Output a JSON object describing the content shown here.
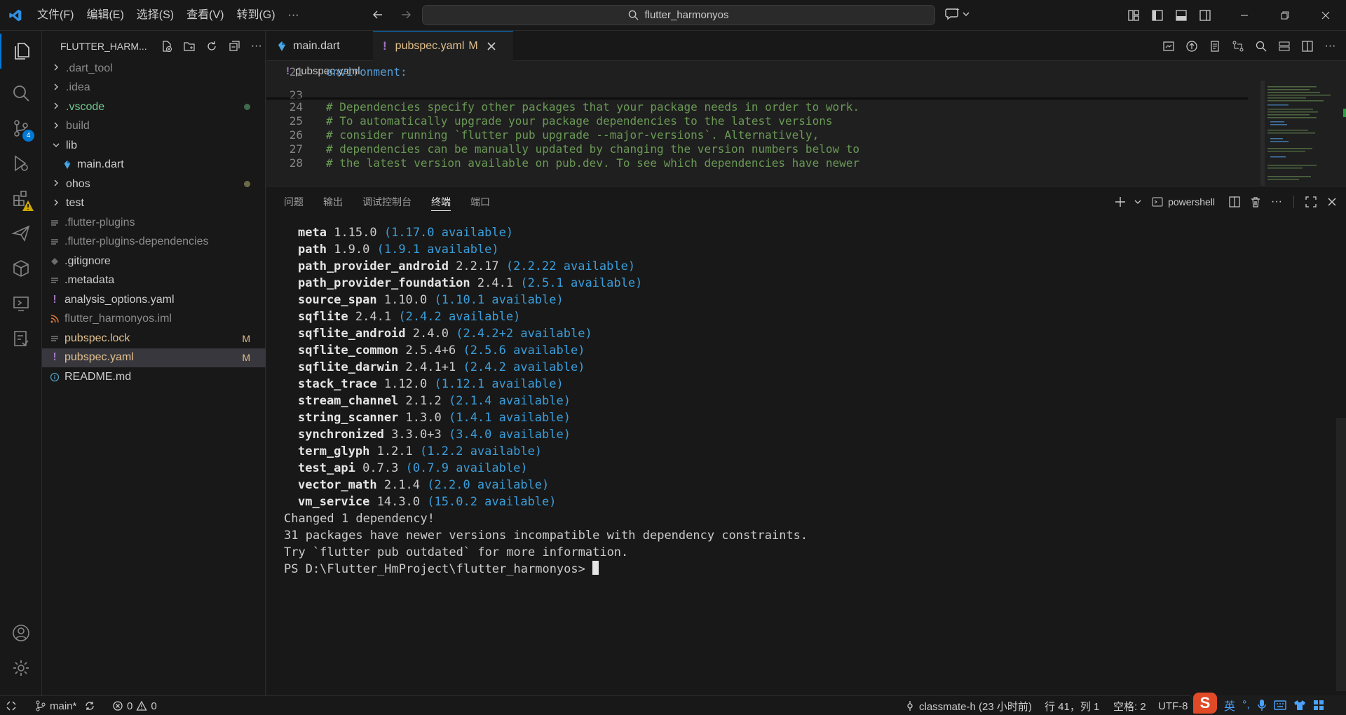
{
  "titlebar": {
    "menus": [
      "文件(F)",
      "编辑(E)",
      "选择(S)",
      "查看(V)",
      "转到(G)",
      "···"
    ],
    "search": "flutter_harmonyos"
  },
  "activity": {
    "source_control_badge": "4"
  },
  "explorer": {
    "title": "FLUTTER_HARM...",
    "items": [
      {
        "label": ".dart_tool",
        "type": "folder",
        "color": "#8b8b8b",
        "deco": ""
      },
      {
        "label": ".idea",
        "type": "folder",
        "color": "#8b8b8b",
        "deco": ""
      },
      {
        "label": ".vscode",
        "type": "folder",
        "color": "#73c991",
        "deco": "dot-green"
      },
      {
        "label": "build",
        "type": "folder",
        "color": "#8b8b8b",
        "deco": ""
      },
      {
        "label": "lib",
        "type": "folder-open",
        "color": "#cccccc",
        "deco": ""
      },
      {
        "label": "main.dart",
        "type": "dart",
        "color": "#cccccc",
        "deco": ""
      },
      {
        "label": "ohos",
        "type": "folder",
        "color": "#cccccc",
        "deco": "dot"
      },
      {
        "label": "test",
        "type": "folder",
        "color": "#cccccc",
        "deco": ""
      },
      {
        "label": ".flutter-plugins",
        "type": "lines",
        "color": "#8b8b8b",
        "deco": ""
      },
      {
        "label": ".flutter-plugins-dependencies",
        "type": "lines",
        "color": "#8b8b8b",
        "deco": ""
      },
      {
        "label": ".gitignore",
        "type": "git",
        "color": "#cccccc",
        "deco": ""
      },
      {
        "label": ".metadata",
        "type": "lines",
        "color": "#cccccc",
        "deco": ""
      },
      {
        "label": "analysis_options.yaml",
        "type": "yaml",
        "color": "#cccccc",
        "deco": ""
      },
      {
        "label": "flutter_harmonyos.iml",
        "type": "rss",
        "color": "#8b8b8b",
        "deco": ""
      },
      {
        "label": "pubspec.lock",
        "type": "lines",
        "color": "#e2c08d",
        "deco": "M"
      },
      {
        "label": "pubspec.yaml",
        "type": "yaml",
        "color": "#e2c08d",
        "deco": "M",
        "selected": true
      },
      {
        "label": "README.md",
        "type": "info",
        "color": "#cccccc",
        "deco": ""
      }
    ]
  },
  "tabs": [
    {
      "label": "main.dart",
      "active": false
    },
    {
      "label": "pubspec.yaml",
      "modified": "M",
      "active": true
    }
  ],
  "editor": {
    "breadcrumb": "pubspec.yaml",
    "lines": [
      {
        "n": "21",
        "text": "environment:",
        "kind": "key"
      },
      {
        "n": "23",
        "text": "",
        "kind": "plain"
      },
      {
        "n": "24",
        "text": "# Dependencies specify other packages that your package needs in order to work.",
        "kind": "comment"
      },
      {
        "n": "25",
        "text": "# To automatically upgrade your package dependencies to the latest versions",
        "kind": "comment"
      },
      {
        "n": "26",
        "text": "# consider running `flutter pub upgrade --major-versions`. Alternatively,",
        "kind": "comment"
      },
      {
        "n": "27",
        "text": "# dependencies can be manually updated by changing the version numbers below to",
        "kind": "comment"
      },
      {
        "n": "28",
        "text": "# the latest version available on pub.dev. To see which dependencies have newer",
        "kind": "comment"
      }
    ]
  },
  "panel": {
    "tabs": [
      "问题",
      "输出",
      "调试控制台",
      "终端",
      "端口"
    ],
    "active_tab": "终端",
    "shell": "powershell"
  },
  "terminal": {
    "packages": [
      {
        "name": "meta",
        "version": "1.15.0",
        "available": "(1.17.0 available)"
      },
      {
        "name": "path",
        "version": "1.9.0",
        "available": "(1.9.1 available)"
      },
      {
        "name": "path_provider_android",
        "version": "2.2.17",
        "available": "(2.2.22 available)"
      },
      {
        "name": "path_provider_foundation",
        "version": "2.4.1",
        "available": "(2.5.1 available)"
      },
      {
        "name": "source_span",
        "version": "1.10.0",
        "available": "(1.10.1 available)"
      },
      {
        "name": "sqflite",
        "version": "2.4.1",
        "available": "(2.4.2 available)"
      },
      {
        "name": "sqflite_android",
        "version": "2.4.0",
        "available": "(2.4.2+2 available)"
      },
      {
        "name": "sqflite_common",
        "version": "2.5.4+6",
        "available": "(2.5.6 available)"
      },
      {
        "name": "sqflite_darwin",
        "version": "2.4.1+1",
        "available": "(2.4.2 available)"
      },
      {
        "name": "stack_trace",
        "version": "1.12.0",
        "available": "(1.12.1 available)"
      },
      {
        "name": "stream_channel",
        "version": "2.1.2",
        "available": "(2.1.4 available)"
      },
      {
        "name": "string_scanner",
        "version": "1.3.0",
        "available": "(1.4.1 available)"
      },
      {
        "name": "synchronized",
        "version": "3.3.0+3",
        "available": "(3.4.0 available)"
      },
      {
        "name": "term_glyph",
        "version": "1.2.1",
        "available": "(1.2.2 available)"
      },
      {
        "name": "test_api",
        "version": "0.7.3",
        "available": "(0.7.9 available)"
      },
      {
        "name": "vector_math",
        "version": "2.1.4",
        "available": "(2.2.0 available)"
      },
      {
        "name": "vm_service",
        "version": "14.3.0",
        "available": "(15.0.2 available)"
      }
    ],
    "messages": [
      "Changed 1 dependency!",
      "31 packages have newer versions incompatible with dependency constraints.",
      "Try `flutter pub outdated` for more information."
    ],
    "prompt": "PS D:\\Flutter_HmProject\\flutter_harmonyos> "
  },
  "statusbar": {
    "branch": "main*",
    "errors": "0",
    "warnings": "0",
    "blame": "classmate-h (23 小时前)",
    "position": "行 41，列 1",
    "spaces": "空格: 2",
    "encoding": "UTF-8"
  },
  "ime": {
    "lang": "英",
    "punct": "°,"
  }
}
